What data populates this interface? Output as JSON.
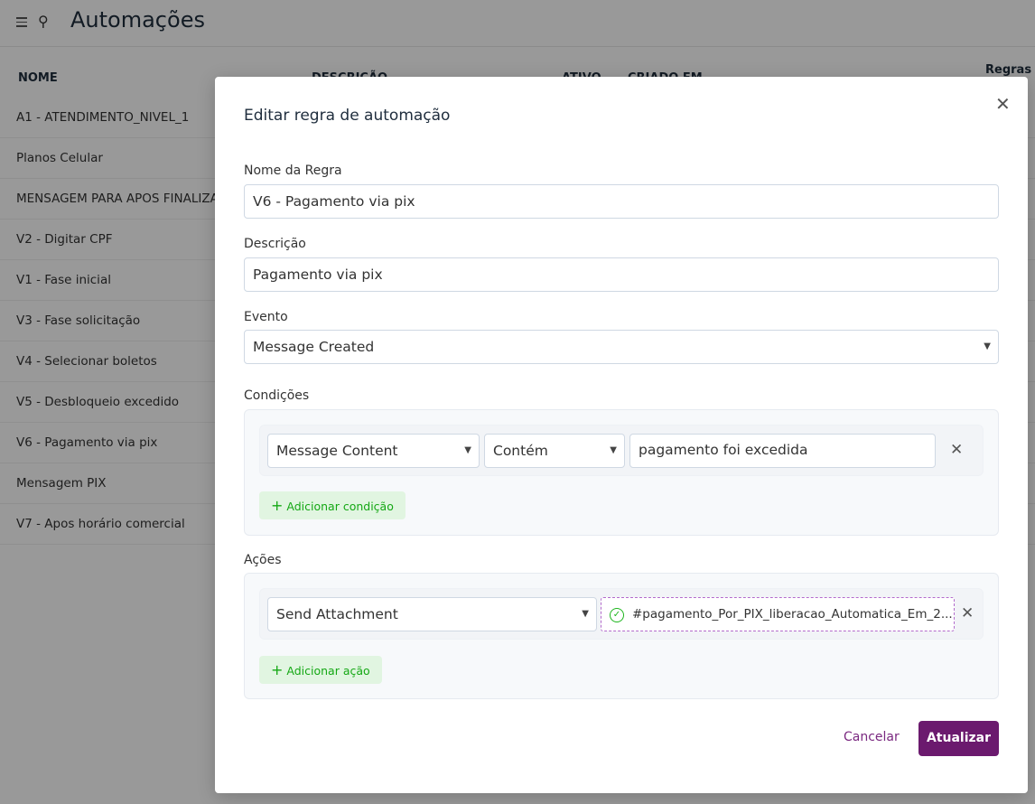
{
  "header": {
    "title": "Automações"
  },
  "table": {
    "headers": [
      "NOME",
      "DESCRIÇÃO",
      "ATIVO",
      "CRIADO EM"
    ],
    "rows": [
      "A1 - ATENDIMENTO_NIVEL_1",
      "Planos Celular",
      "MENSAGEM PARA APOS FINALIZAR",
      "V2 - Digitar CPF",
      "V1 - Fase inicial",
      "V3 - Fase solicitação",
      "V4 - Selecionar boletos",
      "V5 - Desbloqueio excedido",
      "V6 - Pagamento via pix",
      "Mensagem PIX",
      "V7 - Apos horário comercial"
    ]
  },
  "side": {
    "title": "Regras d"
  },
  "modal": {
    "title": "Editar regra de automação",
    "name_label": "Nome da Regra",
    "name_value": "V6 - Pagamento via pix",
    "desc_label": "Descrição",
    "desc_value": "Pagamento via pix",
    "event_label": "Evento",
    "event_value": "Message Created",
    "conditions_label": "Condições",
    "condition": {
      "attribute": "Message Content",
      "operator": "Contém",
      "value": "pagamento foi excedida"
    },
    "add_condition": "Adicionar condição",
    "actions_label": "Ações",
    "action": {
      "type": "Send Attachment",
      "file": "#pagamento_Por_PIX_liberacao_Automatica_Em_2..."
    },
    "add_action": "Adicionar ação",
    "cancel": "Cancelar",
    "submit": "Atualizar"
  },
  "colors": {
    "primary": "#6b1a6e",
    "success": "#14a814"
  }
}
